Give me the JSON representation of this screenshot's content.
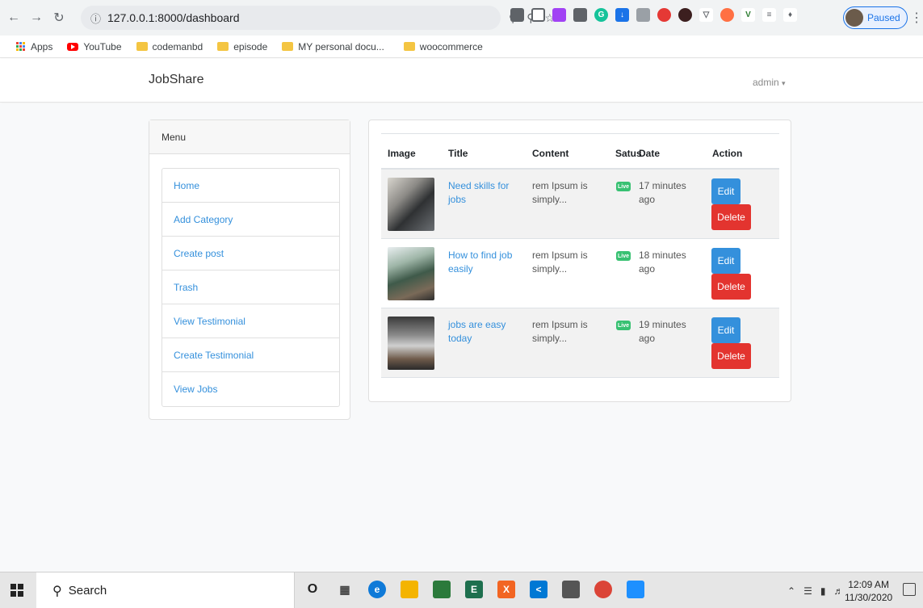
{
  "browser": {
    "url": "127.0.0.1:8000/dashboard",
    "profile_status": "Paused",
    "bookmarks": [
      {
        "label": "Apps",
        "icon": "apps-grid-icon"
      },
      {
        "label": "YouTube",
        "icon": "youtube-icon"
      },
      {
        "label": "codemanbd",
        "icon": "folder-icon"
      },
      {
        "label": "episode",
        "icon": "folder-icon"
      },
      {
        "label": "MY personal docu...",
        "icon": "folder-icon"
      },
      {
        "label": "woocommerce",
        "icon": "folder-icon"
      }
    ]
  },
  "navbar": {
    "brand": "JobShare",
    "user": "admin"
  },
  "menu": {
    "title": "Menu",
    "items": [
      {
        "label": "Home"
      },
      {
        "label": "Add Category"
      },
      {
        "label": "Create post"
      },
      {
        "label": "Trash"
      },
      {
        "label": "View Testimonial"
      },
      {
        "label": "Create Testimonial"
      },
      {
        "label": "View Jobs"
      }
    ]
  },
  "posts_table": {
    "headers": {
      "image": "Image",
      "title": "Title",
      "content": "Content",
      "status": "Satus",
      "date": "Date",
      "action": "Action"
    },
    "rows": [
      {
        "title": "Need skills for jobs",
        "content": "rem Ipsum is simply...",
        "status": "Live",
        "date": "17 minutes ago",
        "edit": "Edit",
        "delete": "Delete"
      },
      {
        "title": "How to find job easily",
        "content": "rem Ipsum is simply...",
        "status": "Live",
        "date": "18 minutes ago",
        "edit": "Edit",
        "delete": "Delete"
      },
      {
        "title": "jobs are easy today",
        "content": "rem Ipsum is simply...",
        "status": "Live",
        "date": "19 minutes ago",
        "edit": "Edit",
        "delete": "Delete"
      }
    ]
  },
  "taskbar": {
    "search_placeholder": "Search",
    "time": "12:09 AM",
    "date": "11/30/2020"
  },
  "colors": {
    "link": "#3490dc",
    "edit": "#3490dc",
    "delete": "#e3342f",
    "live": "#38c172"
  }
}
